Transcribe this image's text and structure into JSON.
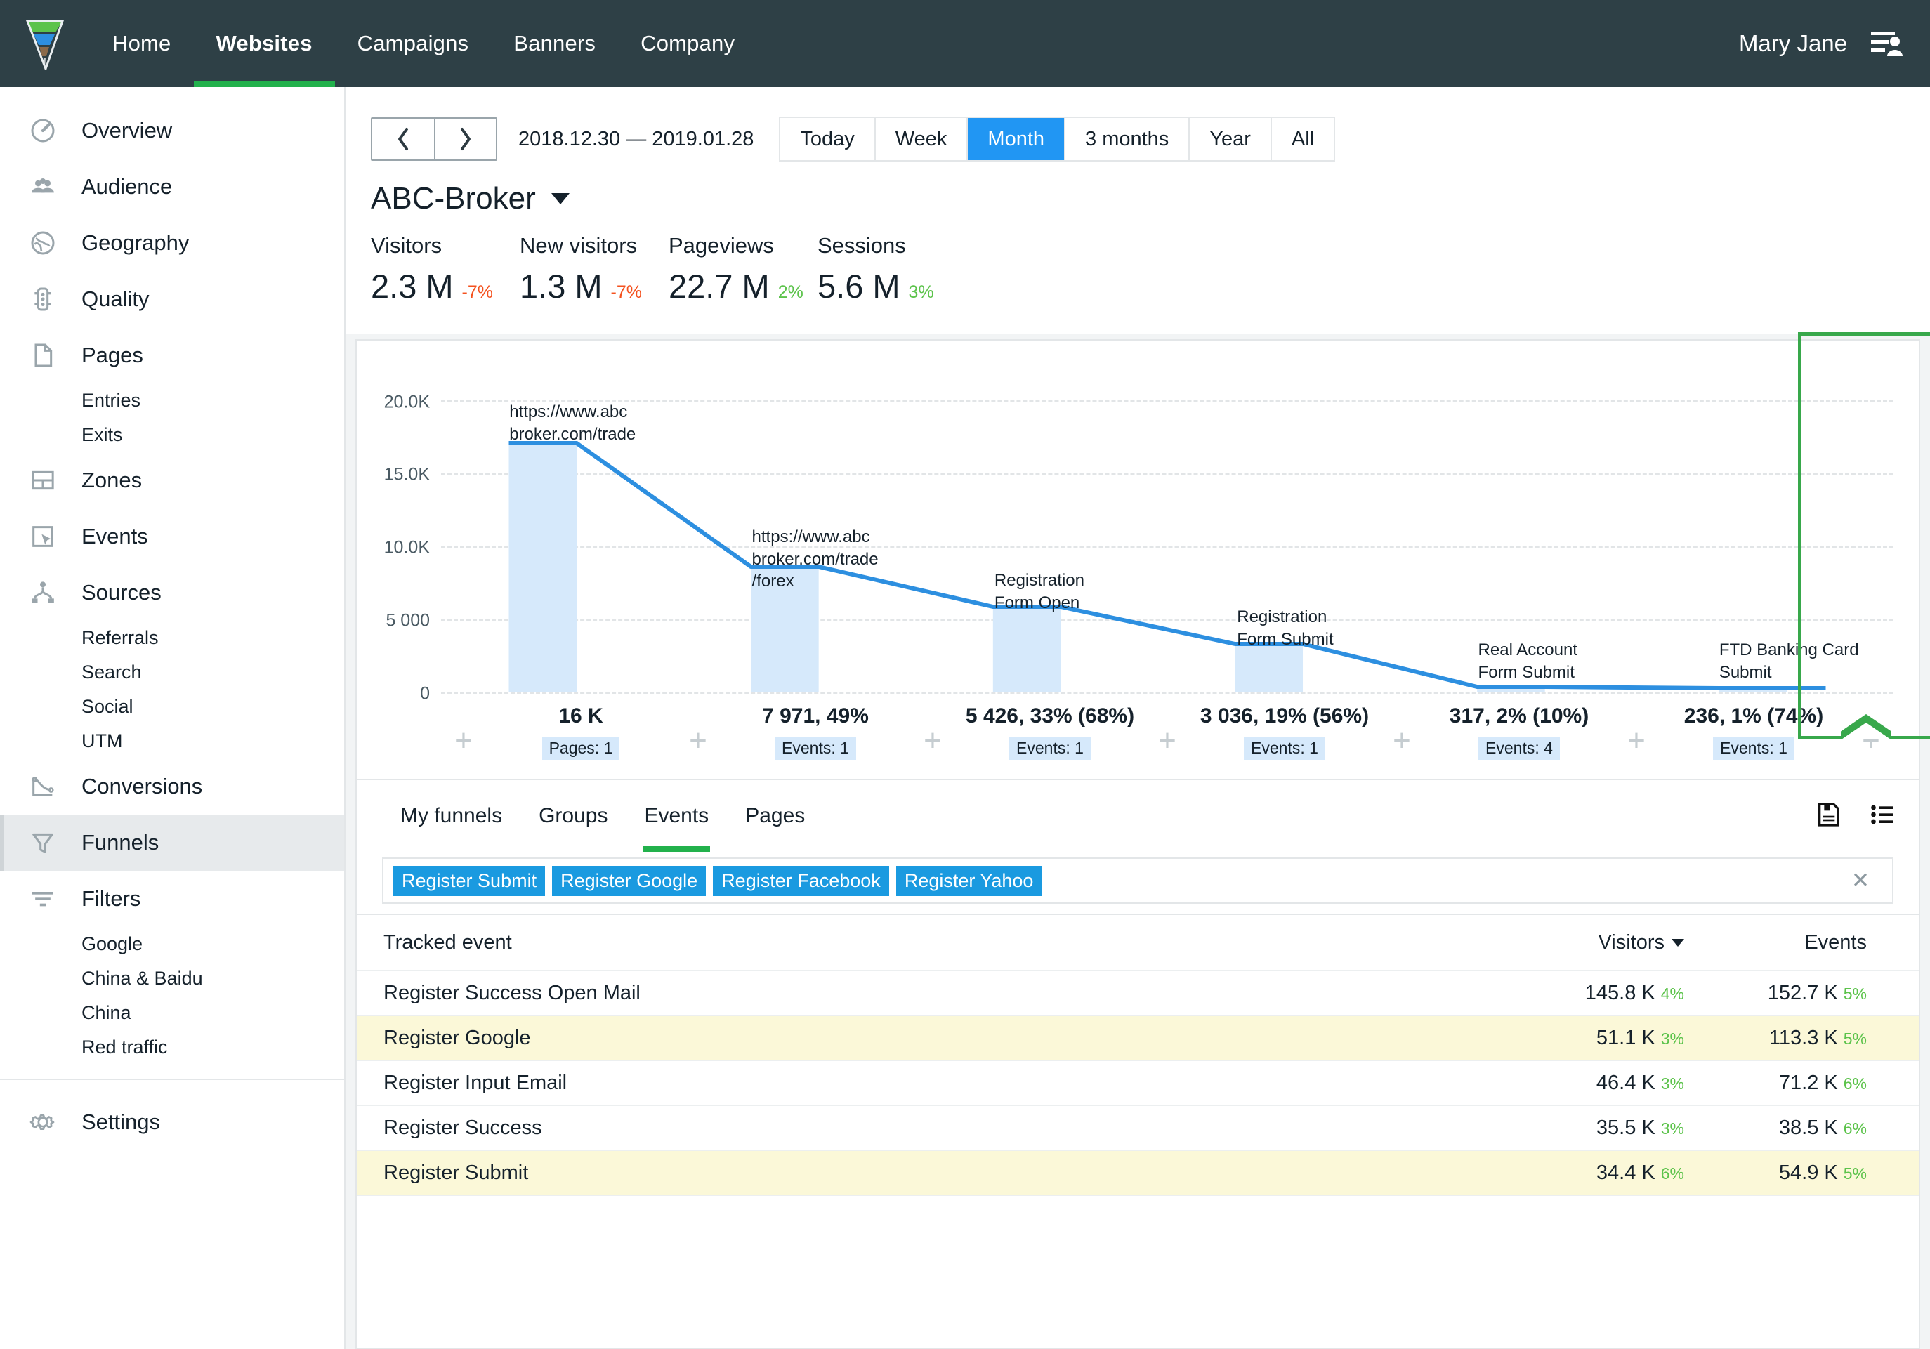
{
  "topnav": {
    "logo_icon": "funnel-logo-icon",
    "items": [
      {
        "label": "Home",
        "active": false
      },
      {
        "label": "Websites",
        "active": true
      },
      {
        "label": "Campaigns",
        "active": false
      },
      {
        "label": "Banners",
        "active": false
      },
      {
        "label": "Company",
        "active": false
      }
    ],
    "user_name": "Mary Jane",
    "user_icon": "user-list-icon"
  },
  "sidebar": {
    "items": [
      {
        "label": "Overview",
        "icon": "gauge-icon",
        "type": "item",
        "active": false
      },
      {
        "label": "Audience",
        "icon": "people-icon",
        "type": "item",
        "active": false
      },
      {
        "label": "Geography",
        "icon": "globe-icon",
        "type": "item",
        "active": false
      },
      {
        "label": "Quality",
        "icon": "traffic-light-icon",
        "type": "item",
        "active": false
      },
      {
        "label": "Pages",
        "icon": "page-icon",
        "type": "item",
        "active": false
      },
      {
        "label": "Entries",
        "icon": "",
        "type": "sub",
        "active": false
      },
      {
        "label": "Exits",
        "icon": "",
        "type": "sub",
        "active": false
      },
      {
        "label": "Zones",
        "icon": "zones-icon",
        "type": "item",
        "active": false
      },
      {
        "label": "Events",
        "icon": "cursor-click-icon",
        "type": "item",
        "active": false
      },
      {
        "label": "Sources",
        "icon": "sources-branch-icon",
        "type": "item",
        "active": false
      },
      {
        "label": "Referrals",
        "icon": "",
        "type": "sub",
        "active": false
      },
      {
        "label": "Search",
        "icon": "",
        "type": "sub",
        "active": false
      },
      {
        "label": "Social",
        "icon": "",
        "type": "sub",
        "active": false
      },
      {
        "label": "UTM",
        "icon": "",
        "type": "sub",
        "active": false
      },
      {
        "label": "Conversions",
        "icon": "conversions-curve-icon",
        "type": "item",
        "active": false
      },
      {
        "label": "Funnels",
        "icon": "funnel-icon",
        "type": "item",
        "active": true
      },
      {
        "label": "Filters",
        "icon": "filter-lines-icon",
        "type": "item",
        "active": false
      },
      {
        "label": "Google",
        "icon": "",
        "type": "sub",
        "active": false
      },
      {
        "label": "China & Baidu",
        "icon": "",
        "type": "sub",
        "active": false
      },
      {
        "label": "China",
        "icon": "",
        "type": "sub",
        "active": false
      },
      {
        "label": "Red traffic",
        "icon": "",
        "type": "sub",
        "active": false
      },
      {
        "label": "divider",
        "icon": "",
        "type": "divider",
        "active": false
      },
      {
        "label": "Settings",
        "icon": "gear-icon",
        "type": "item",
        "active": false
      }
    ]
  },
  "toolbar": {
    "prev_icon": "chevron-left-icon",
    "next_icon": "chevron-right-icon",
    "date_range": "2018.12.30  — 2019.01.28",
    "periods": [
      {
        "label": "Today",
        "active": false
      },
      {
        "label": "Week",
        "active": false
      },
      {
        "label": "Month",
        "active": true
      },
      {
        "label": "3 months",
        "active": false
      },
      {
        "label": "Year",
        "active": false
      },
      {
        "label": "All",
        "active": false
      }
    ],
    "active_period_color": "#2196f3"
  },
  "site": {
    "title": "ABC-Broker",
    "dropdown_icon": "chevron-down-icon",
    "kpis": [
      {
        "label": "Visitors",
        "value": "2.3 M",
        "delta": "-7%",
        "direction": "down"
      },
      {
        "label": "New visitors",
        "value": "1.3 M",
        "delta": "-7%",
        "direction": "down"
      },
      {
        "label": "Pageviews",
        "value": "22.7 M",
        "delta": "2%",
        "direction": "up"
      },
      {
        "label": "Sessions",
        "value": "5.6 M",
        "delta": "3%",
        "direction": "up"
      }
    ],
    "delta_down_color": "#f4511e",
    "delta_up_color": "#5cc34b"
  },
  "chart_data": {
    "type": "bar",
    "title": "",
    "xlabel": "",
    "ylabel": "",
    "ylim": [
      0,
      21500
    ],
    "yticks": [
      0,
      5000,
      10000,
      15000,
      20000
    ],
    "ytick_labels": [
      "0",
      "5 000",
      "10.0K",
      "15.0K",
      "20.0K"
    ],
    "grid": true,
    "legend": "none",
    "series_color": "#2d8fe0",
    "fill_color": "#d6e9fb",
    "categories": [
      "https://www.abc\nbroker.com/trade",
      "https://www.abc\nbroker.com/trade\n/forex",
      "Registration\nForm Open",
      "Registration\nForm Submit",
      "Real Account\nForm Submit",
      "FTD Banking Card\nSubmit"
    ],
    "values": [
      16000,
      7971,
      5426,
      3036,
      317,
      236
    ],
    "steps": [
      {
        "label": "https://www.abc\nbroker.com/trade",
        "value": 16000,
        "value_text": "16 K",
        "badge": "Pages: 1",
        "highlighted": false
      },
      {
        "label": "https://www.abc\nbroker.com/trade\n/forex",
        "value": 7971,
        "value_text": "7 971, 49%",
        "badge": "Events: 1",
        "highlighted": false
      },
      {
        "label": "Registration\nForm Open",
        "value": 5426,
        "value_text": "5 426, 33% (68%)",
        "badge": "Events: 1",
        "highlighted": false
      },
      {
        "label": "Registration\nForm Submit",
        "value": 3036,
        "value_text": "3 036, 19% (56%)",
        "badge": "Events: 1",
        "highlighted": false
      },
      {
        "label": "Real Account\nForm Submit",
        "value": 317,
        "value_text": "317, 2% (10%)",
        "badge": "Events: 4",
        "highlighted": true
      },
      {
        "label": "FTD Banking Card\nSubmit",
        "value": 236,
        "value_text": "236, 1% (74%)",
        "badge": "Events: 1",
        "highlighted": false
      }
    ],
    "add_step_icon": "plus-icon",
    "highlight_color": "#38a84b"
  },
  "tabs": {
    "items": [
      {
        "label": "My funnels",
        "active": false
      },
      {
        "label": "Groups",
        "active": false
      },
      {
        "label": "Events",
        "active": true
      },
      {
        "label": "Pages",
        "active": false
      }
    ],
    "active_color": "#22b14c",
    "icons": [
      {
        "name": "save-icon"
      },
      {
        "name": "list-icon"
      }
    ]
  },
  "filter_chips": {
    "chips": [
      "Register Submit",
      "Register Google",
      "Register Facebook",
      "Register Yahoo"
    ],
    "clear_label": "✕",
    "chip_color": "#1a9ae0"
  },
  "table": {
    "columns": [
      "Tracked event",
      "Visitors",
      "Events"
    ],
    "sort_column": "Visitors",
    "sort_icon": "caret-down-icon",
    "rows": [
      {
        "name": "Register Success Open Mail",
        "visitors": "145.8 K",
        "visitors_pct": "4%",
        "events": "152.7 K",
        "events_pct": "5%",
        "highlighted": false
      },
      {
        "name": "Register Google",
        "visitors": "51.1 K",
        "visitors_pct": "3%",
        "events": "113.3 K",
        "events_pct": "5%",
        "highlighted": true
      },
      {
        "name": "Register Input Email",
        "visitors": "46.4 K",
        "visitors_pct": "3%",
        "events": "71.2 K",
        "events_pct": "6%",
        "highlighted": false
      },
      {
        "name": "Register Success",
        "visitors": "35.5 K",
        "visitors_pct": "3%",
        "events": "38.5 K",
        "events_pct": "6%",
        "highlighted": false
      },
      {
        "name": "Register Submit",
        "visitors": "34.4 K",
        "visitors_pct": "6%",
        "events": "54.9 K",
        "events_pct": "5%",
        "highlighted": true
      }
    ],
    "highlight_row_color": "#fbf8d8",
    "pct_color": "#5cc34b"
  }
}
